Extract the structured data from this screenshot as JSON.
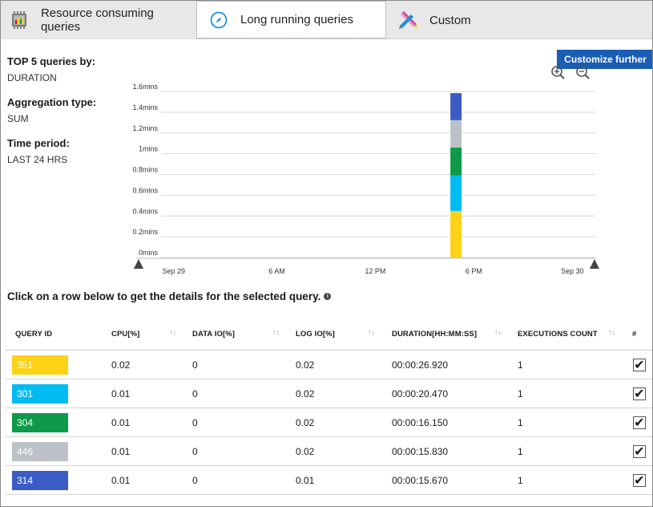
{
  "tabs": [
    {
      "label": "Resource consuming queries",
      "icon": "chip-icon"
    },
    {
      "label": "Long running queries",
      "icon": "compass-icon"
    },
    {
      "label": "Custom",
      "icon": "tools-icon"
    }
  ],
  "info": {
    "top_label": "TOP 5 queries by:",
    "top_value": "DURATION",
    "agg_label": "Aggregation type:",
    "agg_value": "SUM",
    "period_label": "Time period:",
    "period_value": "LAST 24 HRS"
  },
  "customize_label": "Customize further",
  "zoom_in_icon": "zoom-in-icon",
  "zoom_out_icon": "zoom-out-icon",
  "chart_data": {
    "type": "bar",
    "stacked": true,
    "y_ticks": [
      "0mins",
      "0.2mins",
      "0.4mins",
      "0.6mins",
      "0.8mins",
      "1mins",
      "1.2mins",
      "1.4mins",
      "1.6mins"
    ],
    "ylim": [
      0,
      1.6
    ],
    "x_ticks": [
      "Sep 29",
      "6 AM",
      "12 PM",
      "6 PM",
      "Sep 30"
    ],
    "x_tick_pos": [
      0.08,
      0.305,
      0.52,
      0.735,
      0.95
    ],
    "bar_position": 0.696,
    "series": [
      {
        "name": "351",
        "color": "#fcd116",
        "value": 0.449
      },
      {
        "name": "301",
        "color": "#00bcf2",
        "value": 0.341
      },
      {
        "name": "304",
        "color": "#0e9a48",
        "value": 0.269
      },
      {
        "name": "446",
        "color": "#bcc1c7",
        "value": 0.264
      },
      {
        "name": "314",
        "color": "#3b5cc4",
        "value": 0.261
      }
    ]
  },
  "hint": "Click on a row below to get the details for the selected query.",
  "table": {
    "headers": [
      "QUERY ID",
      "CPU[%]",
      "DATA IO[%]",
      "LOG IO[%]",
      "DURATION[HH:MM:SS]",
      "EXECUTIONS COUNT",
      "#"
    ],
    "rows": [
      {
        "id": "351",
        "color": "#fcd116",
        "cpu": "0.02",
        "data_io": "0",
        "log_io": "0.02",
        "duration": "00:00:26.920",
        "exec": "1",
        "checked": true
      },
      {
        "id": "301",
        "color": "#00bcf2",
        "cpu": "0.01",
        "data_io": "0",
        "log_io": "0.02",
        "duration": "00:00:20.470",
        "exec": "1",
        "checked": true
      },
      {
        "id": "304",
        "color": "#0e9a48",
        "cpu": "0.01",
        "data_io": "0",
        "log_io": "0.02",
        "duration": "00:00:16.150",
        "exec": "1",
        "checked": true
      },
      {
        "id": "446",
        "color": "#bcc1c7",
        "cpu": "0.01",
        "data_io": "0",
        "log_io": "0.02",
        "duration": "00:00:15.830",
        "exec": "1",
        "checked": true
      },
      {
        "id": "314",
        "color": "#3b5cc4",
        "cpu": "0.01",
        "data_io": "0",
        "log_io": "0.01",
        "duration": "00:00:15.670",
        "exec": "1",
        "checked": true
      }
    ]
  }
}
